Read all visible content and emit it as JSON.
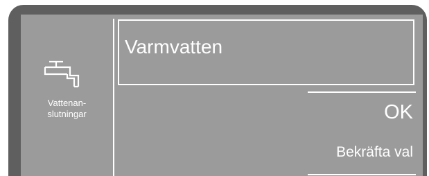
{
  "sidebar": {
    "icon": "water-tap-icon",
    "label_line1": "Vattenan-",
    "label_line2": "slutningar"
  },
  "menu": {
    "selected_item": "Varmvatten",
    "ok_label": "OK",
    "confirm_label": "Bekräfta val"
  },
  "colors": {
    "bezel": "#5f5f5f",
    "display": "#9b9b9b",
    "text": "#ffffff"
  }
}
